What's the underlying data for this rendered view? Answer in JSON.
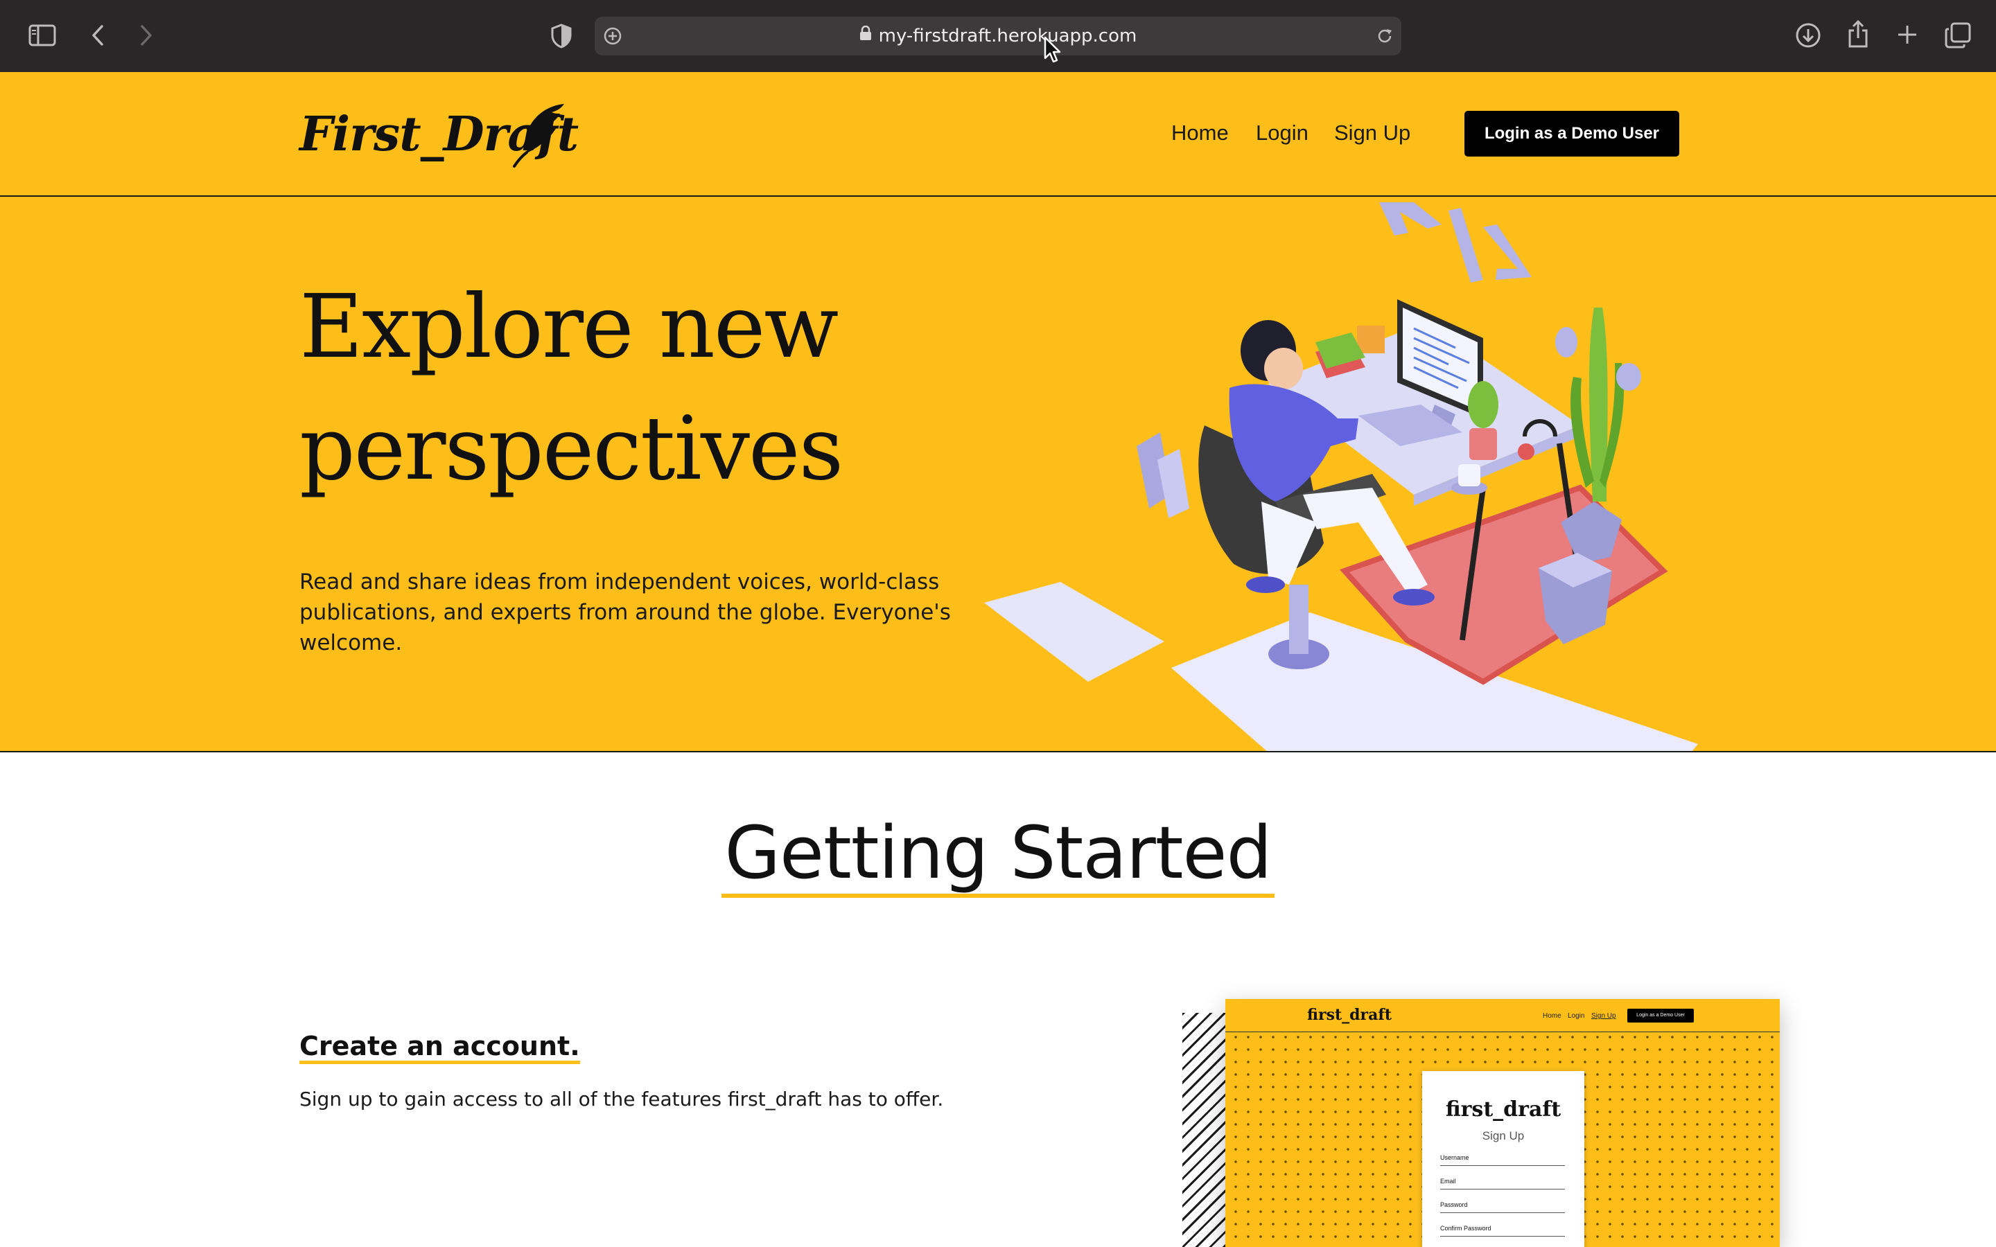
{
  "browser": {
    "url": "my-firstdraft.herokuapp.com",
    "icons": [
      "sidebar-icon",
      "back-icon",
      "forward-icon",
      "shield-icon",
      "site-settings-icon",
      "lock-icon",
      "reload-icon",
      "download-icon",
      "share-icon",
      "new-tab-icon",
      "tab-overview-icon"
    ]
  },
  "header": {
    "logo_text": "First_Draft",
    "nav": [
      {
        "label": "Home"
      },
      {
        "label": "Login"
      },
      {
        "label": "Sign Up"
      }
    ],
    "demo_button": "Login as a Demo User"
  },
  "hero": {
    "title_line1": "Explore new",
    "title_line2": "perspectives",
    "subtitle": "Read and share ideas from independent voices, world-class publications, and experts from around the globe. Everyone's welcome."
  },
  "getting_started": {
    "title": "Getting Started",
    "step": {
      "title": "Create an account.",
      "text": "Sign up to gain access to all of the features first_draft has to offer."
    },
    "preview": {
      "logo": "first_draft",
      "nav": [
        "Home",
        "Login",
        "Sign Up"
      ],
      "button": "Login as a Demo User",
      "card_title": "first_draft",
      "card_subtitle": "Sign Up",
      "fields": [
        "Username",
        "Email",
        "Password",
        "Confirm Password"
      ]
    }
  },
  "colors": {
    "brand_yellow": "#fdbe1a",
    "chrome_dark": "#2a2728",
    "text_dark": "#111111"
  }
}
